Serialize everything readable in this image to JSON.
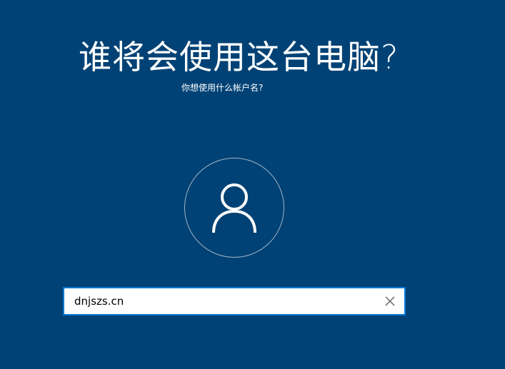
{
  "page": {
    "title": "谁将会使用这台电脑?",
    "subtitle": "你想使用什么帐户名?"
  },
  "account_input": {
    "value": "dnjszs.cn"
  },
  "icons": {
    "avatar": "user-icon",
    "clear": "close-icon"
  },
  "colors": {
    "background": "#004275",
    "input_border": "#0078d7",
    "avatar_ring": "#9eb3c8"
  }
}
